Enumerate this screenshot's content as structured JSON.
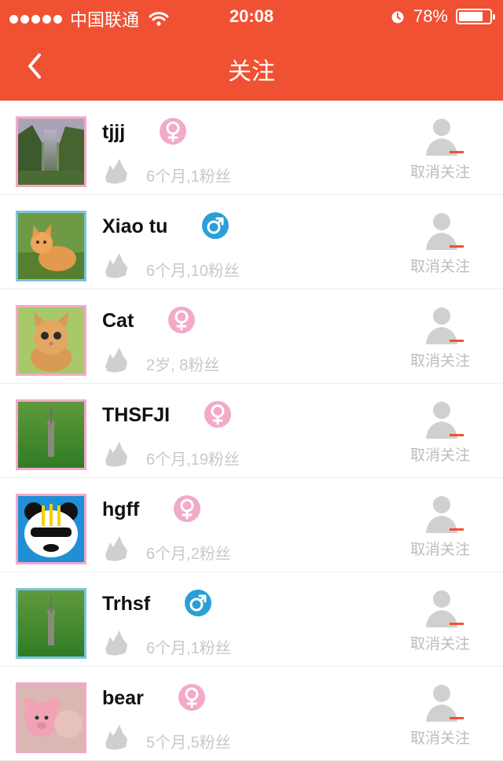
{
  "status_bar": {
    "carrier": "中国联通",
    "time": "20:08",
    "battery_text": "78%",
    "battery_level": 0.78
  },
  "nav": {
    "title": "关注",
    "back_icon": "chevron-left-icon"
  },
  "colors": {
    "header_bg": "#f05133",
    "female": "#f3a9c9",
    "male": "#2a9fd8",
    "muted_text": "#c8c8c8"
  },
  "follows": [
    {
      "name": "tjjj",
      "gender": "female",
      "meta": "6个月,1粉丝",
      "action": "取消关注"
    },
    {
      "name": "Xiao tu",
      "gender": "male",
      "meta": "6个月,10粉丝",
      "action": "取消关注"
    },
    {
      "name": "Cat",
      "gender": "female",
      "meta": "2岁, 8粉丝",
      "action": "取消关注"
    },
    {
      "name": "THSFJI",
      "gender": "female",
      "meta": "6个月,19粉丝",
      "action": "取消关注"
    },
    {
      "name": "hgff",
      "gender": "female",
      "meta": "6个月,2粉丝",
      "action": "取消关注"
    },
    {
      "name": "Trhsf",
      "gender": "male",
      "meta": "6个月,1粉丝",
      "action": "取消关注"
    },
    {
      "name": "bear",
      "gender": "female",
      "meta": "5个月,5粉丝",
      "action": "取消关注"
    }
  ]
}
